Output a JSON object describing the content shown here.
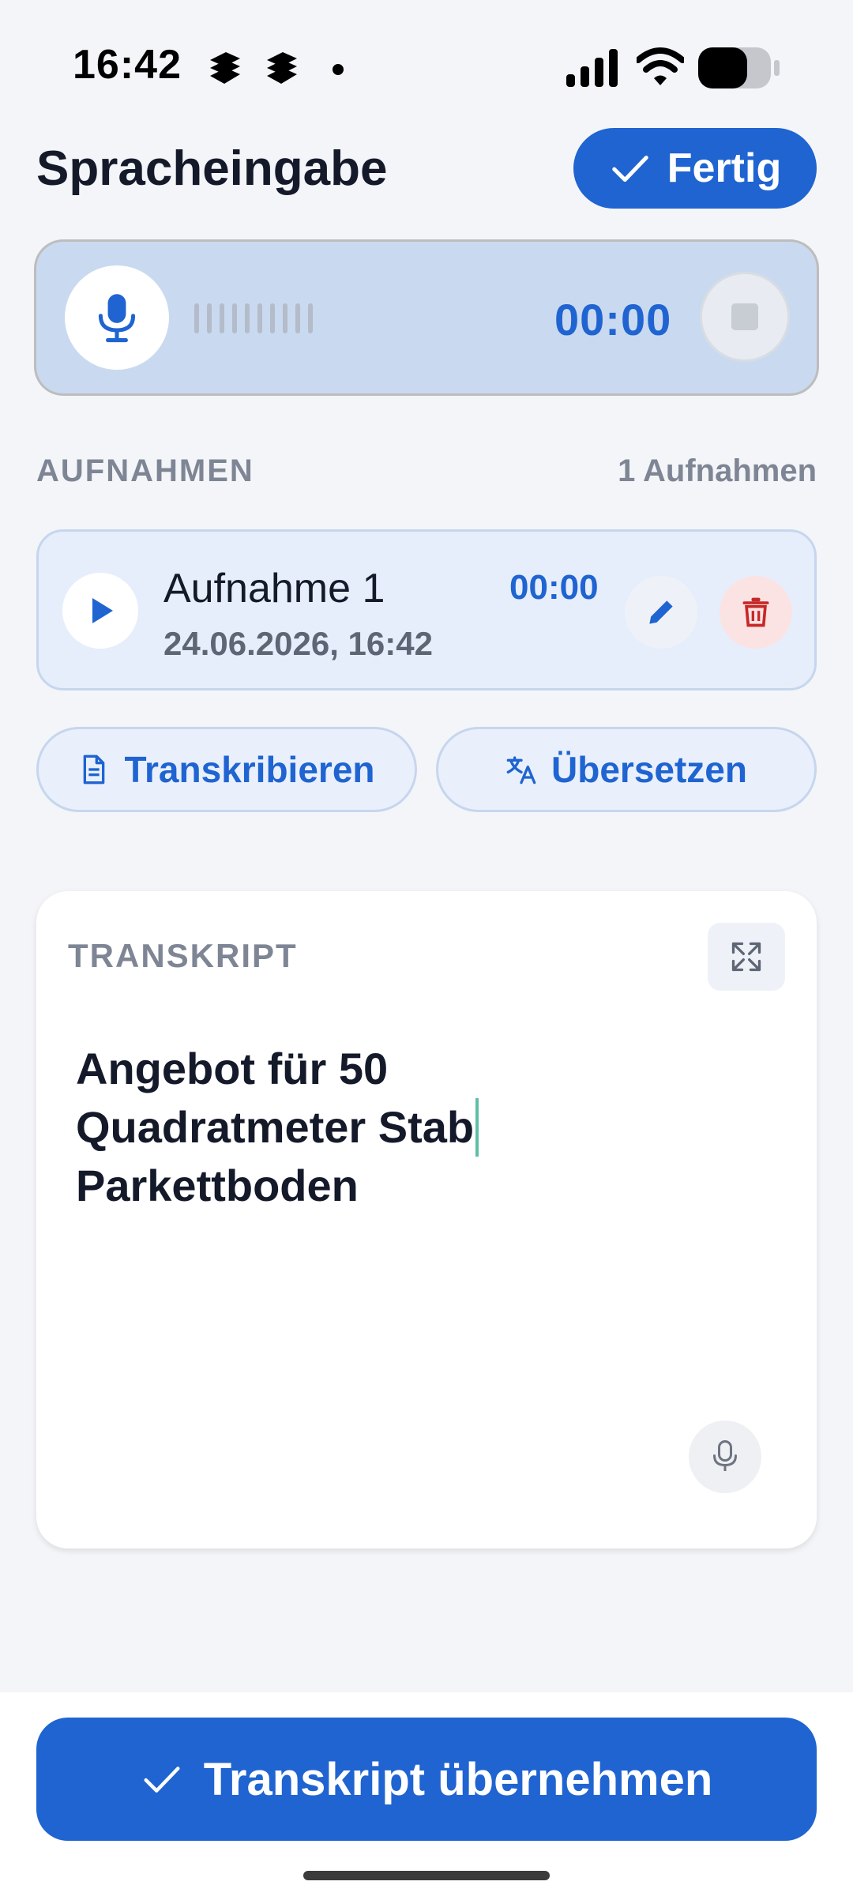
{
  "status_bar": {
    "time": "16:42",
    "icons": [
      "notification-app-icon",
      "notification-app-icon",
      "dot-icon",
      "signal-icon",
      "wifi-icon",
      "battery-icon"
    ]
  },
  "header": {
    "title": "Spracheingabe",
    "done_label": "Fertig"
  },
  "recorder": {
    "timer": "00:00"
  },
  "recordings": {
    "section_label": "AUFNAHMEN",
    "count_label": "1 Aufnahmen",
    "items": [
      {
        "name": "Aufnahme 1",
        "date": "24.06.2026, 16:42",
        "duration": "00:00"
      }
    ]
  },
  "actions": {
    "transcribe_label": "Transkribieren",
    "translate_label": "Übersetzen"
  },
  "transcript": {
    "label": "TRANSKRIPT",
    "lines": [
      "Angebot für 50",
      "Quadratmeter Stab",
      "Parkettboden"
    ]
  },
  "footer": {
    "apply_label": "Transkript übernehmen"
  },
  "colors": {
    "accent": "#1f64d1",
    "background": "#f4f5f8",
    "recorder_bg": "#c9d9f0",
    "card_bg": "#e6eefb",
    "danger": "#c62828",
    "caret": "#5fbfa6"
  }
}
